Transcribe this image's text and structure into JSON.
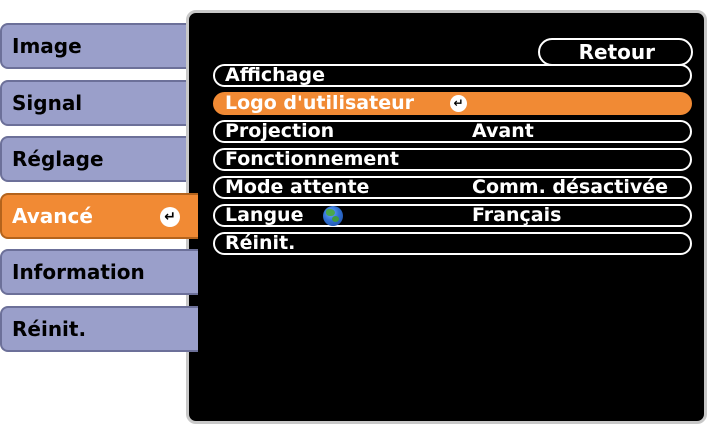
{
  "sidebar": {
    "items": [
      {
        "label": "Image"
      },
      {
        "label": "Signal"
      },
      {
        "label": "Réglage"
      },
      {
        "label": "Avancé"
      },
      {
        "label": "Information"
      },
      {
        "label": "Réinit."
      }
    ],
    "active_index": 3
  },
  "back_button": {
    "label": "Retour"
  },
  "menu": {
    "rows": [
      {
        "label": "Affichage",
        "value": ""
      },
      {
        "label": "Logo d'utilisateur",
        "value": ""
      },
      {
        "label": "Projection",
        "value": "Avant"
      },
      {
        "label": "Fonctionnement",
        "value": ""
      },
      {
        "label": "Mode attente",
        "value": "Comm. désactivée"
      },
      {
        "label": "Langue",
        "value": "Français"
      },
      {
        "label": "Réinit.",
        "value": ""
      }
    ],
    "selected_index": 1
  },
  "icons": {
    "enter": "enter-icon",
    "globe": "globe-icon"
  },
  "colors": {
    "accent": "#f18a34",
    "tab": "#9a9fca",
    "screen": "#000000"
  }
}
